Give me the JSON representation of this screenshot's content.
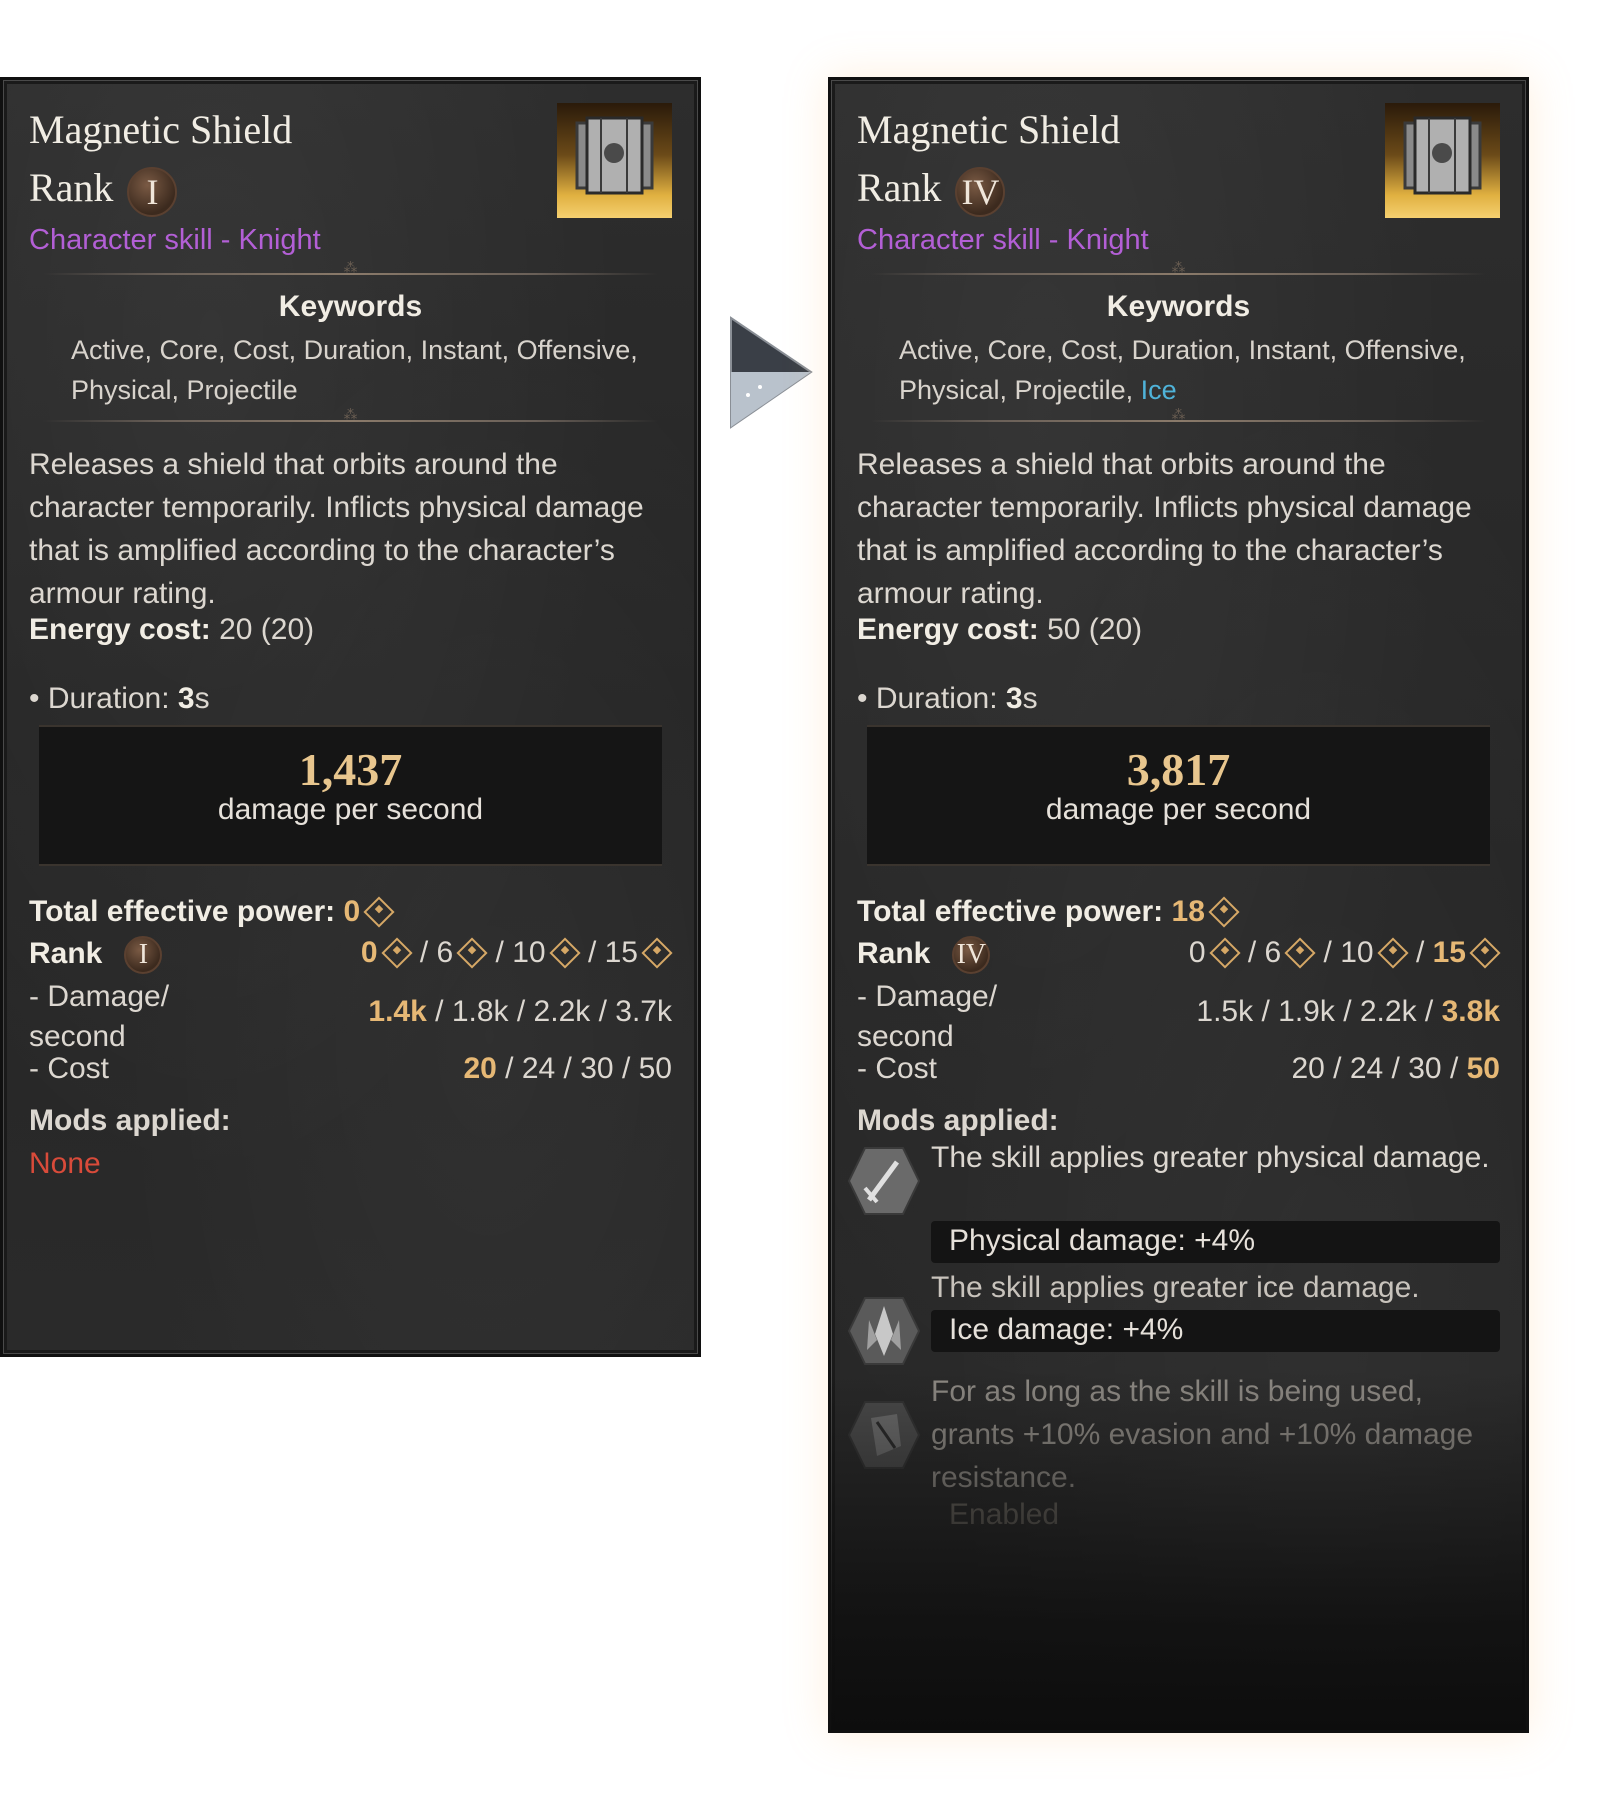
{
  "left": {
    "title": "Magnetic Shield",
    "rank_label": "Rank",
    "rank_roman": "I",
    "subtitle": "Character skill - Knight",
    "keywords_title": "Keywords",
    "keywords_line1": "Active, Core, Cost, Duration, Instant, Offensive,",
    "keywords_line2": "Physical, Projectile",
    "description": "Releases a shield that orbits around the character temporarily. Inflicts physical damage that is amplified according to the character’s armour rating.",
    "energy_label": "Energy cost:",
    "energy_value": "20",
    "energy_base": "(20)",
    "duration_label": "• Duration:",
    "duration_value": "3",
    "duration_unit": "s",
    "dps_value": "1,437",
    "dps_label": "damage per second",
    "tep_label": "Total effective power:",
    "tep_value": "0",
    "rank_row_label": "Rank",
    "rank_row_roman": "I",
    "power_tiers": [
      "0",
      "6",
      "10",
      "15"
    ],
    "damage_label_1": "- Damage/",
    "damage_label_2": "second",
    "damage_values": [
      "1.4k",
      "1.8k",
      "2.2k",
      "3.7k"
    ],
    "cost_label": "- Cost",
    "cost_values": [
      "20",
      "24",
      "30",
      "50"
    ],
    "mods_label": "Mods applied:",
    "mods_none": "None"
  },
  "right": {
    "title": "Magnetic Shield",
    "rank_label": "Rank",
    "rank_roman": "IV",
    "subtitle": "Character skill - Knight",
    "keywords_title": "Keywords",
    "keywords_line1": "Active, Core, Cost, Duration, Instant, Offensive,",
    "keywords_line2": "Physical, Projectile,",
    "keywords_extra": "Ice",
    "description": "Releases a shield that orbits around the character temporarily. Inflicts physical damage that is amplified according to the character’s armour rating.",
    "energy_label": "Energy cost:",
    "energy_value": "50",
    "energy_base": "(20)",
    "duration_label": "• Duration:",
    "duration_value": "3",
    "duration_unit": "s",
    "dps_value": "3,817",
    "dps_label": "damage per second",
    "tep_label": "Total effective power:",
    "tep_value": "18",
    "rank_row_label": "Rank",
    "rank_row_roman": "IV",
    "power_tiers": [
      "0",
      "6",
      "10",
      "15"
    ],
    "damage_label_1": "- Damage/",
    "damage_label_2": "second",
    "damage_values": [
      "1.5k",
      "1.9k",
      "2.2k",
      "3.8k"
    ],
    "cost_label": "- Cost",
    "cost_values": [
      "20",
      "24",
      "30",
      "50"
    ],
    "mods_label": "Mods applied:",
    "mods": [
      {
        "icon": "sword-icon",
        "text": "The skill applies greater physical damage.",
        "bonus": "Physical damage: +4%"
      },
      {
        "icon": "ice-crystal-icon",
        "text": "The skill applies greater ice damage.",
        "bonus": "Ice damage: +4%"
      },
      {
        "icon": "shield-crack-icon",
        "text": "For as long as the skill is being used, grants +10% evasion and +10% damage resistance.",
        "bonus": "Enabled"
      }
    ]
  },
  "colors": {
    "gold": "#e6b875",
    "purple_subtitle": "#b35fd6",
    "ice_keyword": "#4fb3d9",
    "none_red": "#d94b3a"
  }
}
